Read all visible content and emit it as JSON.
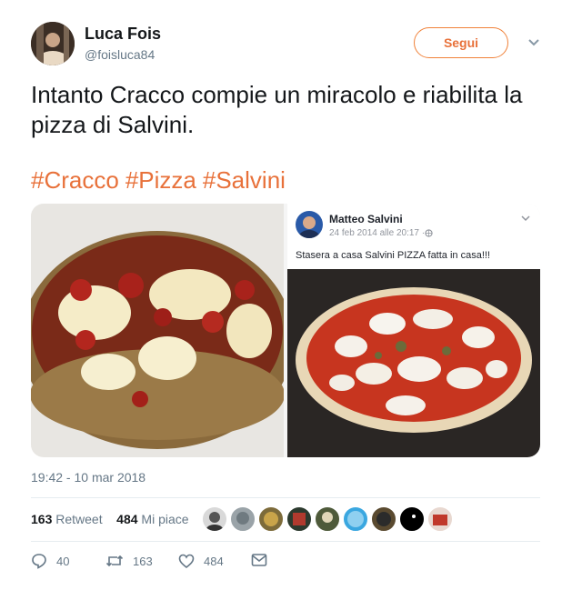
{
  "author": {
    "name": "Luca Fois",
    "handle": "@foisluca84"
  },
  "follow_label": "Segui",
  "tweet_text": "Intanto Cracco compie un miracolo e riabilita la pizza di Salvini.",
  "hashtags": [
    "#Cracco",
    "#Pizza",
    "#Salvini"
  ],
  "embedded_post": {
    "author": "Matteo Salvini",
    "date": "24 feb 2014 alle 20:17 · ",
    "text": "Stasera a casa Salvini PIZZA fatta in casa!!!"
  },
  "timestamp": "19:42 - 10 mar 2018",
  "stats": {
    "retweets_count": "163",
    "retweets_label": "Retweet",
    "likes_count": "484",
    "likes_label": "Mi piace"
  },
  "actions": {
    "reply": "40",
    "retweet": "163",
    "like": "484"
  },
  "colors": {
    "accent": "#e8713a",
    "muted": "#657786",
    "text": "#14171a"
  },
  "icons": [
    "chevron-down-icon",
    "reply-icon",
    "retweet-icon",
    "heart-icon",
    "mail-icon",
    "globe-icon"
  ]
}
